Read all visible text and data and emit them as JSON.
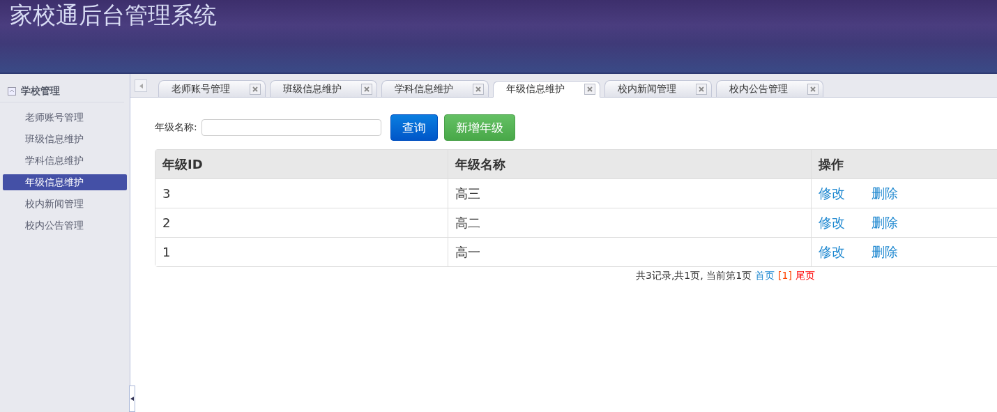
{
  "header": {
    "title": "家校通后台管理系统"
  },
  "sidebar": {
    "group": {
      "title": "学校管理",
      "expanded": true
    },
    "items": [
      {
        "label": "老师账号管理",
        "selected": false
      },
      {
        "label": "班级信息维护",
        "selected": false
      },
      {
        "label": "学科信息维护",
        "selected": false
      },
      {
        "label": "年级信息维护",
        "selected": true
      },
      {
        "label": "校内新闻管理",
        "selected": false
      },
      {
        "label": "校内公告管理",
        "selected": false
      }
    ]
  },
  "tabs": [
    {
      "label": "老师账号管理",
      "selected": false
    },
    {
      "label": "班级信息维护",
      "selected": false
    },
    {
      "label": "学科信息维护",
      "selected": false
    },
    {
      "label": "年级信息维护",
      "selected": true
    },
    {
      "label": "校内新闻管理",
      "selected": false
    },
    {
      "label": "校内公告管理",
      "selected": false
    }
  ],
  "search": {
    "label": "年级名称:",
    "query_button": "查询",
    "add_button": "新增年级"
  },
  "table": {
    "columns": [
      "年级ID",
      "年级名称",
      "操作"
    ],
    "rows": [
      {
        "id": "3",
        "name": "高三",
        "actions": [
          "修改",
          "删除"
        ]
      },
      {
        "id": "2",
        "name": "高二",
        "actions": [
          "修改",
          "删除"
        ]
      },
      {
        "id": "1",
        "name": "高一",
        "actions": [
          "修改",
          "删除"
        ]
      }
    ]
  },
  "pagination": {
    "summary": "共3记录,共1页, 当前第1页",
    "links": [
      {
        "label": "首页",
        "color": "#1e88d0"
      },
      {
        "label": "[1]",
        "color": "#ff4400"
      },
      {
        "label": "尾页",
        "color": "#ff0000"
      }
    ]
  }
}
